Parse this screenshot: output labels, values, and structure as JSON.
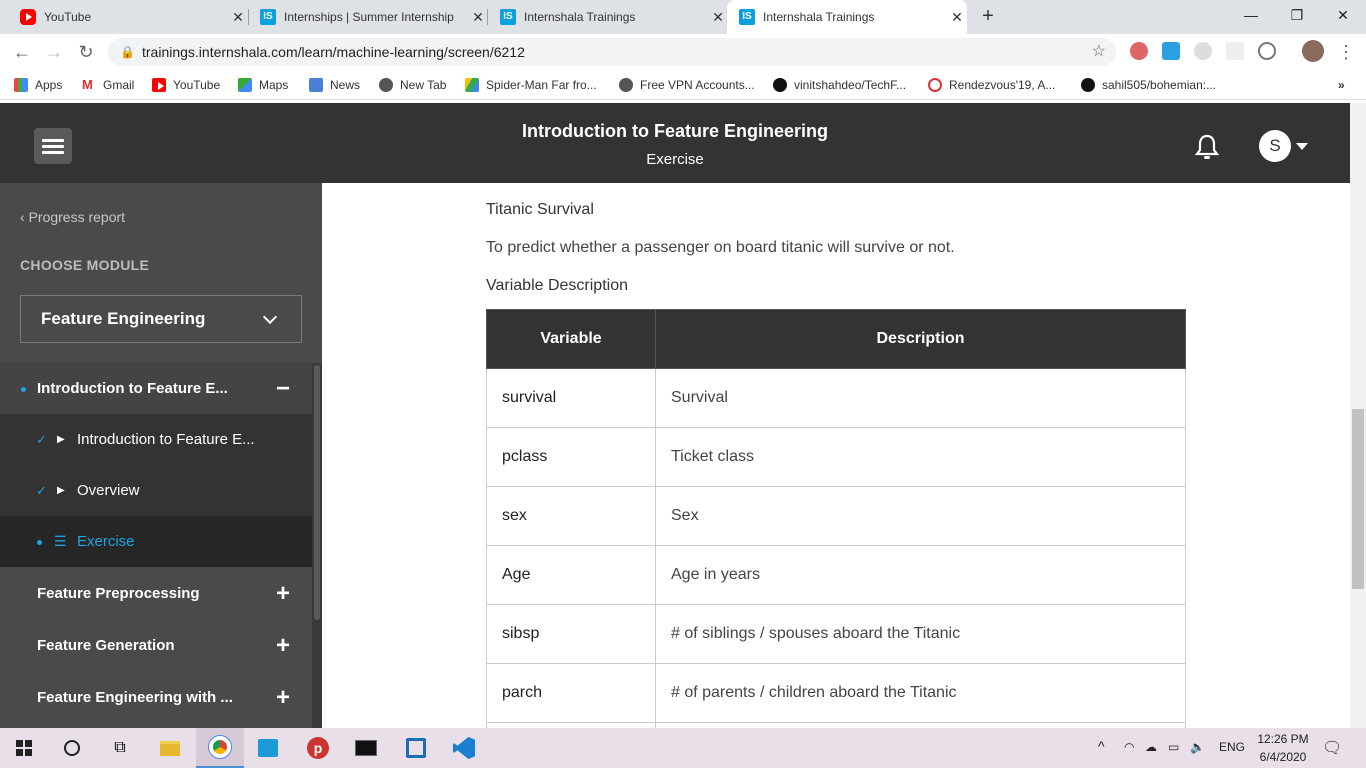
{
  "browser": {
    "tabs": [
      {
        "title": "YouTube",
        "icon": "youtube-icon",
        "active": false
      },
      {
        "title": "Internships | Summer Internship",
        "icon": "internshala-icon",
        "active": false
      },
      {
        "title": "Internshala Trainings",
        "icon": "internshala-icon",
        "active": false
      },
      {
        "title": "Internshala Trainings",
        "icon": "internshala-icon",
        "active": true
      }
    ],
    "url": "trainings.internshala.com/learn/machine-learning/screen/6212",
    "bookmarks": [
      {
        "label": "Apps",
        "icon": "apps-grid-icon"
      },
      {
        "label": "Gmail",
        "icon": "gmail-icon"
      },
      {
        "label": "YouTube",
        "icon": "youtube-icon"
      },
      {
        "label": "Maps",
        "icon": "maps-icon"
      },
      {
        "label": "News",
        "icon": "news-icon"
      },
      {
        "label": "New Tab",
        "icon": "globe-icon"
      },
      {
        "label": "Spider-Man Far fro...",
        "icon": "drive-icon"
      },
      {
        "label": "Free VPN Accounts...",
        "icon": "globe-icon"
      },
      {
        "label": "vinitshahdeo/TechF...",
        "icon": "github-icon"
      },
      {
        "label": "Rendezvous'19, A...",
        "icon": "rendezvous-icon"
      },
      {
        "label": "sahil505/bohemian:...",
        "icon": "github-icon"
      }
    ]
  },
  "header": {
    "title": "Introduction to Feature Engineering",
    "subtitle": "Exercise",
    "avatar_letter": "S"
  },
  "sidebar": {
    "progress_link": "Progress report",
    "choose_module_label": "CHOOSE MODULE",
    "module_selected": "Feature Engineering",
    "items": [
      {
        "label": "Introduction to Feature E...",
        "state": "expanded"
      },
      {
        "label": "Introduction to Feature E...",
        "state": "completed"
      },
      {
        "label": "Overview",
        "state": "completed"
      },
      {
        "label": "Exercise",
        "state": "current"
      },
      {
        "label": "Feature Preprocessing",
        "state": "collapsed"
      },
      {
        "label": "Feature Generation",
        "state": "collapsed"
      },
      {
        "label": "Feature Engineering with ...",
        "state": "collapsed"
      }
    ]
  },
  "content": {
    "section_title": "Titanic Survival",
    "description": "To predict whether a passenger on board titanic will survive or not.",
    "table_title": "Variable Description",
    "table": {
      "headers": [
        "Variable",
        "Description"
      ],
      "rows": [
        [
          "survival",
          "Survival"
        ],
        [
          "pclass",
          "Ticket class"
        ],
        [
          "sex",
          "Sex"
        ],
        [
          "Age",
          "Age in years"
        ],
        [
          "sibsp",
          "# of siblings / spouses aboard the Titanic"
        ],
        [
          "parch",
          "# of parents / children aboard the Titanic"
        ]
      ]
    }
  },
  "taskbar": {
    "language": "ENG",
    "time": "12:26 PM",
    "date": "6/4/2020"
  },
  "colors": {
    "accent": "#1ea5e0",
    "header_bg": "#333333",
    "sidebar_bg": "#4a4a4a"
  }
}
